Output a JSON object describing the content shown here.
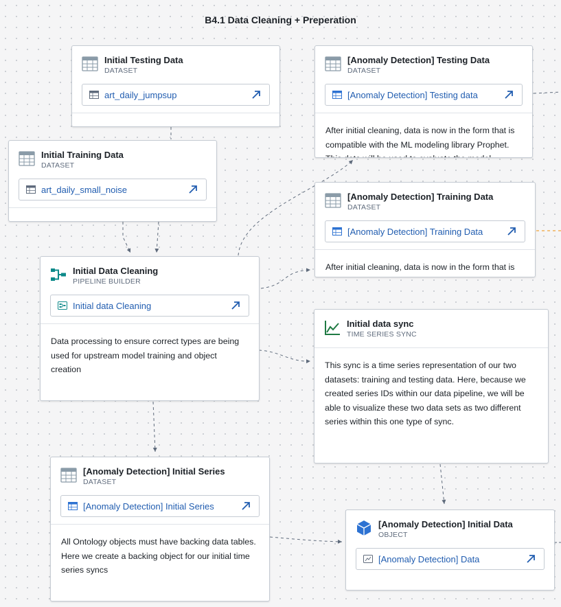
{
  "page_title": "B4.1 Data Cleaning + Preperation",
  "nodes": {
    "initial_testing": {
      "title": "Initial Testing Data",
      "type": "DATASET",
      "link": "art_daily_jumpsup"
    },
    "initial_training": {
      "title": "Initial Training Data",
      "type": "DATASET",
      "link": "art_daily_small_noise"
    },
    "ad_testing": {
      "title": "[Anomaly Detection] Testing Data",
      "type": "DATASET",
      "link": "[Anomaly Detection] Testing data",
      "description": "After initial cleaning, data is now in the form that is compatible with the ML modeling library Prophet. This data will be used to evaluate the model"
    },
    "ad_training": {
      "title": "[Anomaly Detection] Training Data",
      "type": "DATASET",
      "link": "[Anomaly Detection] Training Data",
      "description": "After initial cleaning, data is now in the form that is"
    },
    "initial_cleaning": {
      "title": "Initial Data Cleaning",
      "type": "PIPELINE BUILDER",
      "link": "Initial data Cleaning",
      "description": "Data processing to ensure correct types are being used for upstream model training and object creation"
    },
    "initial_sync": {
      "title": "Initial data sync",
      "type": "TIME SERIES SYNC",
      "description": "This sync is a time series representation of our two datasets: training and testing data. Here, because we created series IDs within our data pipeline, we will be able to visualize these two data sets as two different series within this one type of sync."
    },
    "ad_initial_series": {
      "title": "[Anomaly Detection] Initial Series",
      "type": "DATASET",
      "link": "[Anomaly Detection] Initial Series",
      "description": "All Ontology objects must have backing data tables. Here we create a backing object for our initial time series syncs"
    },
    "ad_initial_data": {
      "title": "[Anomaly Detection] Initial Data",
      "type": "OBJECT",
      "link": "[Anomaly Detection] Data"
    }
  },
  "colors": {
    "link": "#215db0",
    "pipeline_icon": "#0d8a8a",
    "timeseries_icon": "#1f7a43",
    "object_icon": "#2d72d2",
    "edge": "#5f6b7c",
    "edge_highlight": "#f0a33a"
  },
  "icons": {
    "dataset": "dataset-table-icon",
    "pipeline": "pipeline-builder-icon",
    "timeseries": "time-series-icon",
    "object": "object-cube-icon",
    "open": "open-arrow-icon"
  }
}
